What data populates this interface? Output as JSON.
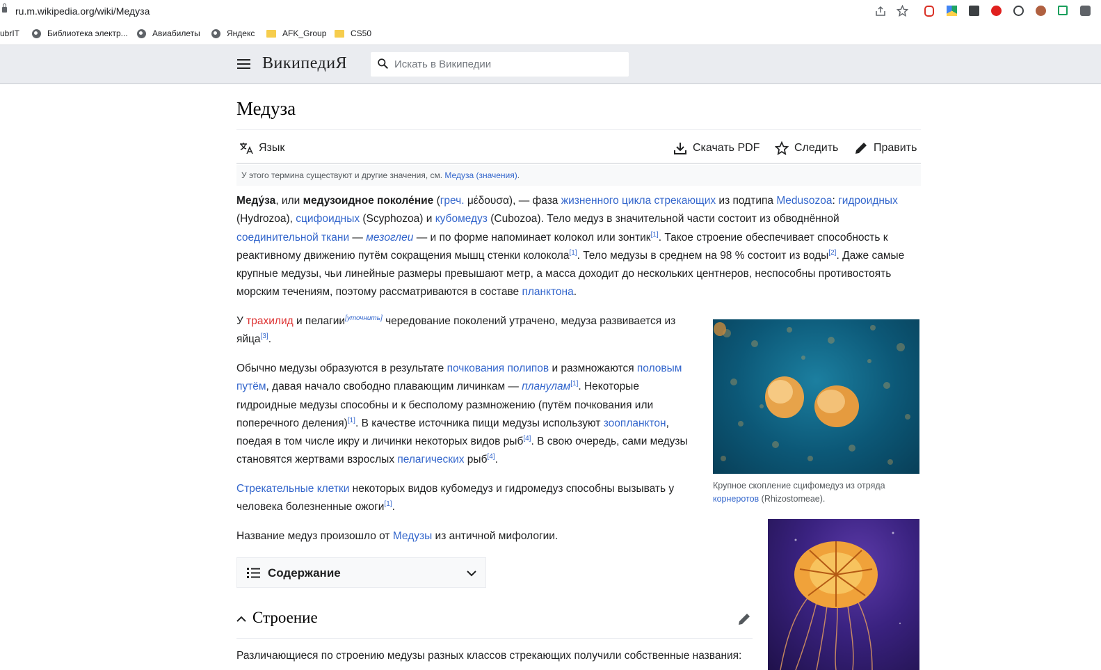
{
  "browser": {
    "url": "ru.m.wikipedia.org/wiki/Медуза",
    "bookmarks": [
      "ubrIT",
      "Библиотека электр...",
      "Авиабилеты",
      "Яндекс",
      "AFK_Group",
      "CS50"
    ]
  },
  "header": {
    "logo": "ВикипедиЯ",
    "search_placeholder": "Искать в Википедии"
  },
  "article": {
    "title": "Медуза",
    "actions": {
      "language": "Язык",
      "download": "Скачать PDF",
      "watch": "Следить",
      "edit": "Править"
    },
    "hatnote": {
      "text": "У этого термина существуют и другие значения, см. ",
      "link": "Медуза (значения)",
      "end": "."
    },
    "p1": {
      "b1": "Меду́за",
      "t1": ", или ",
      "b2": "медузоидное поколе́ние",
      "t2": " (",
      "l1": "греч.",
      "t3": " μέδουσα), — фаза ",
      "l2": "жизненного цикла",
      "t4": " ",
      "l3": "стрекающих",
      "t5": " из подтипа ",
      "l4": "Medusozoa",
      "t6": ": ",
      "l5": "гидроидных",
      "t7": " (Hydrozoa), ",
      "l6": "сцифоидных",
      "t8": " (Scyphozoa) и ",
      "l7": "кубомедуз",
      "t9": " (Cubozoa). Тело медуз в значительной части состоит из обводнённой ",
      "l8": "соединительной ткани",
      "t10": " — ",
      "l9": "мезоглеи",
      "t11": " — и по форме напоминает колокол или зонтик",
      "s1": "[1]",
      "t12": ". Такое строение обеспечивает способность к реактивному движению путём сокращения мышц стенки колокола",
      "s2": "[1]",
      "t13": ". Тело медузы в среднем на 98 % состоит из воды",
      "s3": "[2]",
      "t14": ". Даже самые крупные медузы, чьи линейные размеры превышают метр, а масса доходит до нескольких центнеров, неспособны противостоять морским течениям, поэтому рассматриваются в составе ",
      "l10": "планктона",
      "t15": "."
    },
    "p2": {
      "t1": "У ",
      "l1": "трахилид",
      "t2": " и пелагии",
      "s1": "[уточнить]",
      "t3": " чередование поколений утрачено, медуза развивается из яйца",
      "s2": "[3]",
      "t4": "."
    },
    "p3": {
      "t1": "Обычно медузы образуются в результате ",
      "l1": "почкования",
      "t2": " ",
      "l2": "полипов",
      "t3": " и размножаются ",
      "l3": "половым путём",
      "t4": ", давая начало свободно плавающим личинкам — ",
      "l4": "планулам",
      "s1": "[1]",
      "t5": ". Некоторые гидроидные медузы способны и к бесполому размножению (путём почкования или поперечного деления)",
      "s2": "[1]",
      "t6": ". В качестве источника пищи медузы используют ",
      "l5": "зоопланктон",
      "t7": ", поедая в том числе икру и личинки некоторых видов рыб",
      "s3": "[4]",
      "t8": ". В свою очередь, сами медузы становятся жертвами взрослых ",
      "l6": "пелагических",
      "t9": " рыб",
      "s4": "[4]",
      "t10": "."
    },
    "p4": {
      "l1": "Стрекательные клетки",
      "t1": " некоторых видов кубомедуз и гидромедуз способны вызывать у человека болезненные ожоги",
      "s1": "[1]",
      "t2": "."
    },
    "p5": {
      "t1": "Название медуз произошло от ",
      "l1": "Медузы",
      "t2": " из античной мифологии."
    },
    "figure1": {
      "caption_t1": "Крупное скопление сцифомедуз из отряда ",
      "caption_link": "корнеротов",
      "caption_t2": " (Rhizostomeae)."
    },
    "toc_label": "Содержание",
    "section": {
      "title": "Строение",
      "text": "Различающиеся по строению медузы разных классов стрекающих получили собственные названия:"
    }
  },
  "colors": {
    "link": "#3366cc",
    "redlink": "#d33",
    "header_bg": "#eaecf0"
  }
}
